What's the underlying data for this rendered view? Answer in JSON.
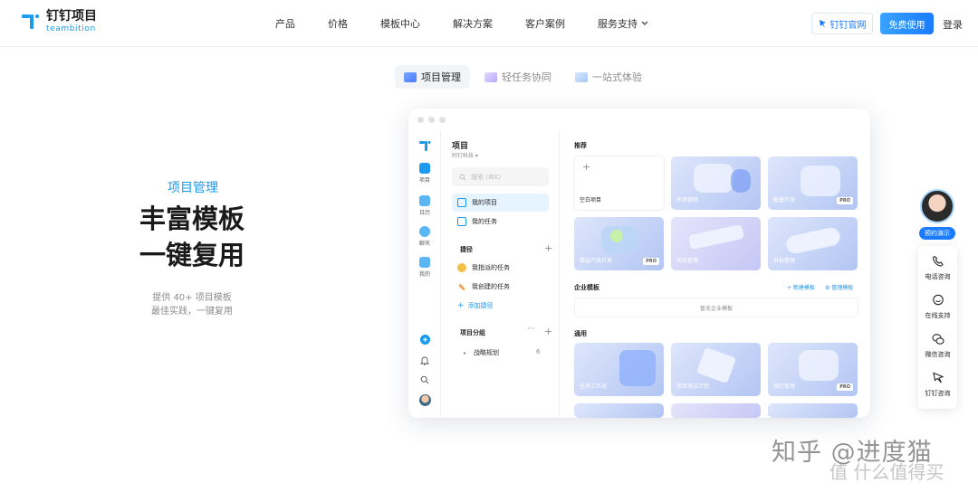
{
  "brand": {
    "name_cn": "钉钉项目",
    "name_en": "teambition",
    "accent": "#1b9aee"
  },
  "nav": {
    "items": [
      "产品",
      "价格",
      "模板中心",
      "解决方案",
      "客户案例",
      "服务支持"
    ],
    "official_site": "钉钉官网",
    "free_trial": "免费使用",
    "login": "登录"
  },
  "feature_tabs": [
    {
      "label": "项目管理",
      "active": true
    },
    {
      "label": "轻任务协同",
      "active": false
    },
    {
      "label": "一站式体验",
      "active": false
    }
  ],
  "hero": {
    "tag": "项目管理",
    "title_line1": "丰富模板",
    "title_line2": "一键复用",
    "sub_line1": "提供 40+ 项目模板",
    "sub_line2": "最佳实践，一键复用"
  },
  "app": {
    "rail": [
      {
        "label": "项目",
        "icon": "project-icon",
        "active": true
      },
      {
        "label": "日历",
        "icon": "calendar-icon",
        "active": false
      },
      {
        "label": "聊天",
        "icon": "chat-icon",
        "active": false
      },
      {
        "label": "我的",
        "icon": "mine-icon",
        "active": false
      }
    ],
    "panel": {
      "title": "项目",
      "org": "阿钉科技 ▾",
      "search_placeholder": "搜索 (⌘K)",
      "my_projects": "我的项目",
      "my_tasks": "我的任务",
      "shortcuts_title": "捷径",
      "assigned_by_me": "我指派的任务",
      "created_by_me": "我创建的任务",
      "add_shortcut": "添加捷径",
      "groups_title": "项目分组",
      "group_name": "战略规划",
      "group_count": "6"
    },
    "main": {
      "recommended_title": "推荐",
      "recommended": [
        {
          "label": "空白项目",
          "blank": true,
          "pro": false
        },
        {
          "label": "市场营销",
          "blank": false,
          "pro": false
        },
        {
          "label": "敏捷开发",
          "blank": false,
          "pro": true
        },
        {
          "label": "精益产品开发",
          "blank": false,
          "pro": true
        },
        {
          "label": "项目管理",
          "blank": false,
          "pro": false
        },
        {
          "label": "目标管理",
          "blank": false,
          "pro": false
        }
      ],
      "enterprise_title": "企业模板",
      "new_template": "+ 新建模板",
      "manage_template": "⚙ 管理模板",
      "enterprise_empty": "暂无企业模板",
      "general_title": "通用",
      "general": [
        {
          "label": "任务工作流",
          "pro": false
        },
        {
          "label": "简单测试计划",
          "pro": false
        },
        {
          "label": "简历管理",
          "pro": true
        }
      ],
      "pro_badge": "PRO"
    }
  },
  "float_bar": {
    "demo": "预约演示",
    "items": [
      "电话咨询",
      "在线支持",
      "微信咨询",
      "钉钉咨询"
    ]
  },
  "watermark": {
    "line1": "知乎 @进度猫",
    "line2": "值 什么值得买"
  }
}
